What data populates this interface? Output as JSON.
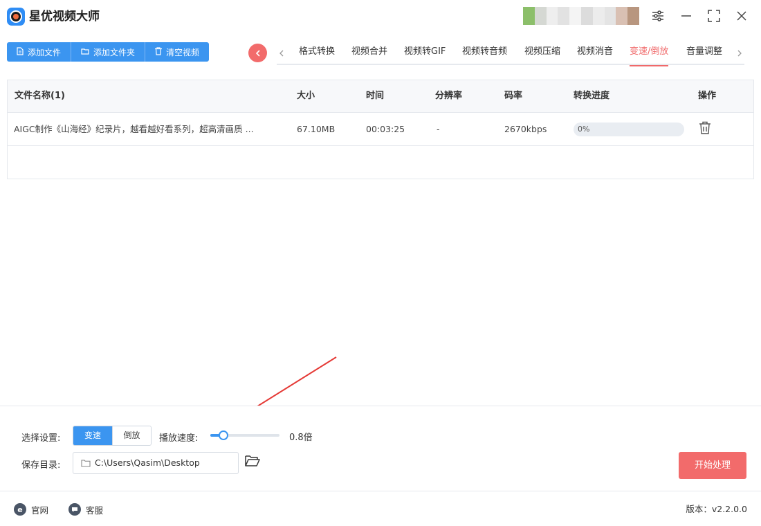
{
  "app": {
    "title": "星优视频大师"
  },
  "window_controls": {
    "settings_icon": "sliders-icon",
    "minimize_icon": "minimize-icon",
    "maximize_icon": "maximize-icon",
    "close_icon": "close-icon"
  },
  "avatar_blur_colors": [
    "#8cbf6a",
    "#d5d8d3",
    "#eeeeee",
    "#e2e2e2",
    "#f4f4f4",
    "#dcdcdc",
    "#ececec",
    "#e4e4e4",
    "#d9c0b3",
    "#b8967f"
  ],
  "toolbar": {
    "add_file": "添加文件",
    "add_folder": "添加文件夹",
    "clear_videos": "清空视频"
  },
  "tabs": [
    {
      "label": "格式转换",
      "active": false
    },
    {
      "label": "视频合并",
      "active": false
    },
    {
      "label": "视频转GIF",
      "active": false
    },
    {
      "label": "视频转音频",
      "active": false
    },
    {
      "label": "视频压缩",
      "active": false
    },
    {
      "label": "视频消音",
      "active": false
    },
    {
      "label": "变速/倒放",
      "active": true
    },
    {
      "label": "音量调整",
      "active": false
    }
  ],
  "table": {
    "headers": {
      "name": "文件名称(1)",
      "size": "大小",
      "time": "时间",
      "resolution": "分辨率",
      "bitrate": "码率",
      "progress": "转换进度",
      "action": "操作"
    },
    "rows": [
      {
        "name": "AIGC制作《山海经》纪录片，越看越好看系列，超高清画质 ...",
        "size": "67.10MB",
        "time": "00:03:25",
        "resolution": "-",
        "bitrate": "2670kbps",
        "progress_text": "0%",
        "progress": 0
      }
    ]
  },
  "settings": {
    "mode_label": "选择设置:",
    "mode_options": {
      "speed": "变速",
      "reverse": "倒放"
    },
    "selected_mode": "变速",
    "speed_label": "播放速度:",
    "speed_value_text": "0.8倍",
    "speed_slider_fraction": 0.19,
    "save_label": "保存目录:",
    "save_path": "C:\\Users\\Qasim\\Desktop",
    "start_button": "开始处理"
  },
  "footer": {
    "website": "官网",
    "support": "客服",
    "version": "版本：v2.2.0.0"
  },
  "colors": {
    "accent_blue": "#3b95f0",
    "accent_red": "#f26b6b",
    "active_tab": "#f0696a",
    "arrow_red": "#e53935"
  }
}
